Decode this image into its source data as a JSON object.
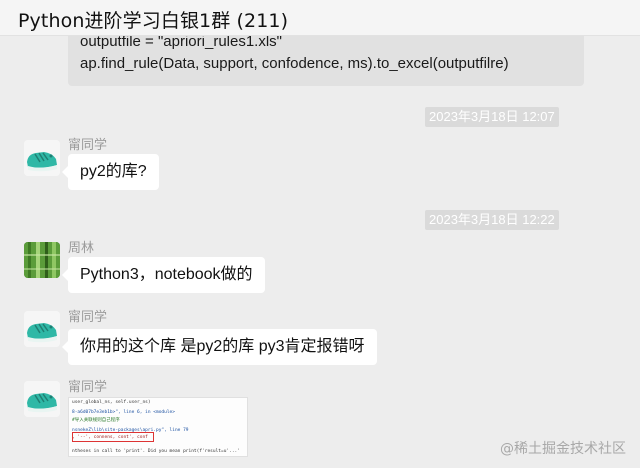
{
  "window": {
    "title": "Python进阶学习白银1群 (211)"
  },
  "code_message": {
    "line1": "outputfile = \"apriori_rules1.xls\"",
    "line2": "ap.find_rule(Data, support, confodence, ms).to_excel(outputfilre)"
  },
  "timestamps": [
    "2023年3月18日 12:07",
    "2023年3月18日 12:22"
  ],
  "messages": [
    {
      "sender": "甯同学",
      "text": "py2的库?"
    },
    {
      "sender": "周林",
      "text": "Python3，notebook做的"
    },
    {
      "sender": "甯同学",
      "text": "你用的这个库 是py2的库 py3肯定报错呀"
    },
    {
      "sender": "甯同学",
      "text": ""
    }
  ],
  "screenshot_lines": [
    "user_global_ns, self.user_ns)",
    "8-a6d07b7e3eb1b>\", line 6, in <module>",
    "#导入关联规则自己程序",
    "nsnekeZ\\lib\\site-packages\\apri.py\", line 79",
    ", '--', connens, cont', conf",
    "ntheses in call to 'print'. Did you mean print(f'result=u'...'"
  ],
  "watermark": "@稀土掘金技术社区"
}
